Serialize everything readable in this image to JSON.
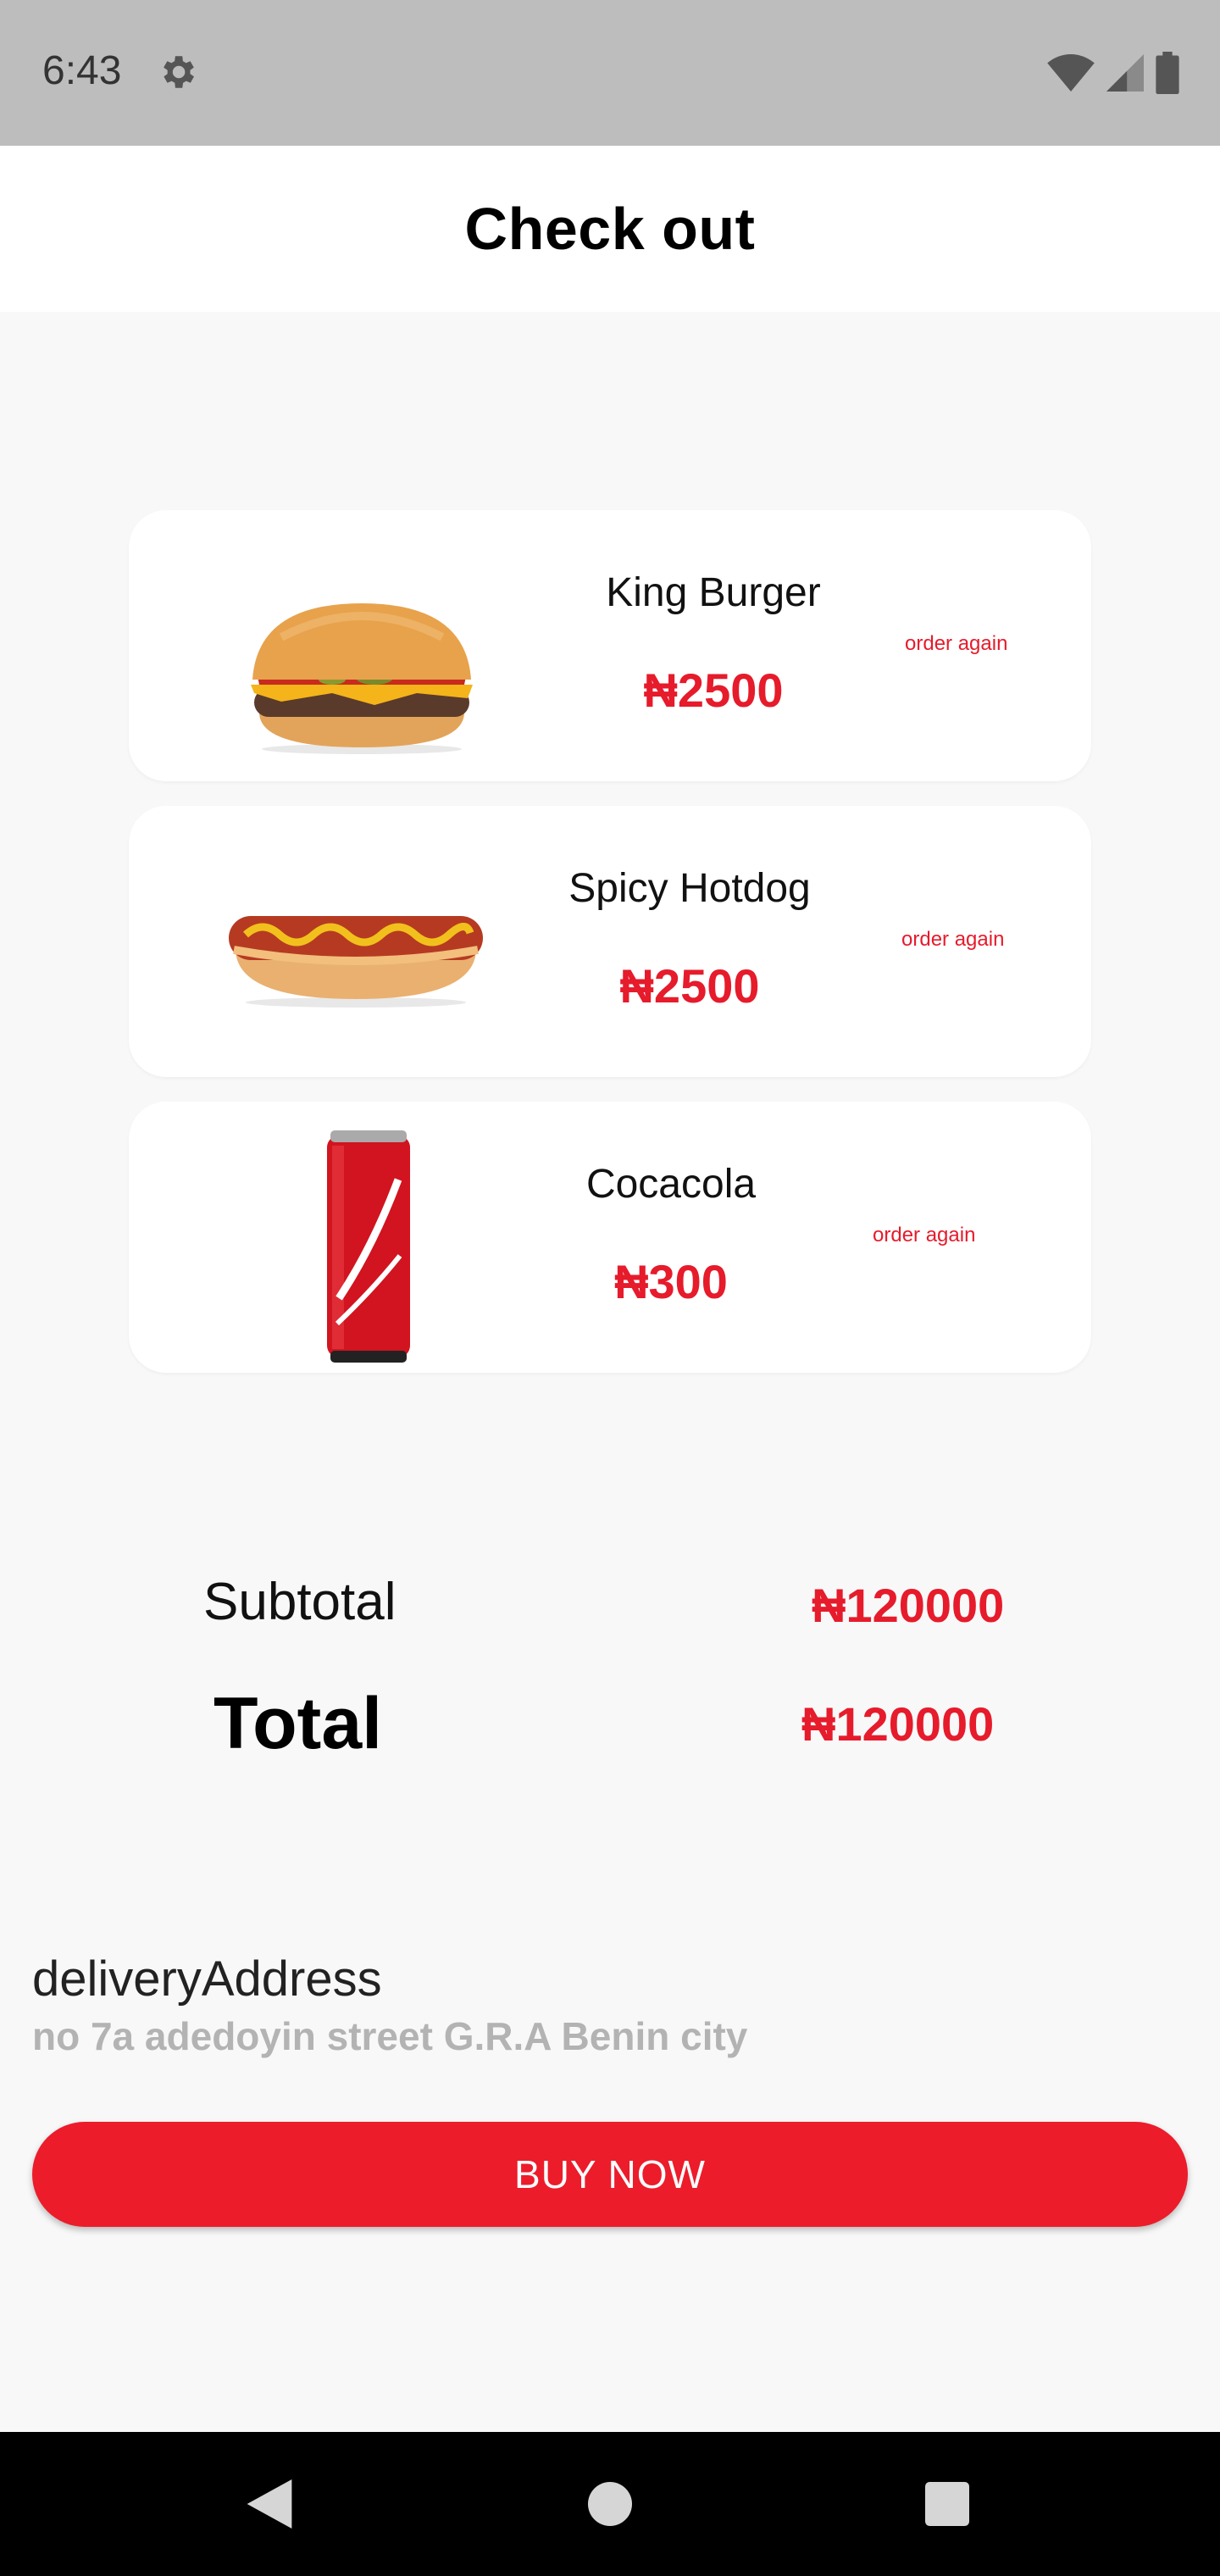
{
  "status_bar": {
    "time": "6:43",
    "icons": [
      "gear-icon",
      "wifi-icon",
      "signal-icon",
      "battery-icon"
    ]
  },
  "app_bar": {
    "title": "Check out"
  },
  "cart_items": [
    {
      "name": "King Burger",
      "price": "₦2500",
      "action_label": "order again",
      "image": "burger-image"
    },
    {
      "name": "Spicy Hotdog",
      "price": "₦2500",
      "action_label": "order again",
      "image": "hotdog-image"
    },
    {
      "name": "Cocacola",
      "price": "₦300",
      "action_label": "order again",
      "image": "cola-can-image"
    }
  ],
  "summary": {
    "subtotal_label": "Subtotal",
    "subtotal_value": "₦120000",
    "total_label": "Total",
    "total_value": "₦120000"
  },
  "delivery": {
    "label": "deliveryAddress",
    "address": "no 7a adedoyin street G.R.A Benin city"
  },
  "buy_button": {
    "label": "BUY NOW"
  },
  "colors": {
    "accent": "#ec1c2b",
    "price": "#e61b2b",
    "background": "#f8f8f8",
    "status_bar": "#bdbdbd",
    "nav_bar": "#000000"
  },
  "nav_bar": {
    "buttons": [
      "back-icon",
      "home-icon",
      "recents-icon"
    ]
  }
}
